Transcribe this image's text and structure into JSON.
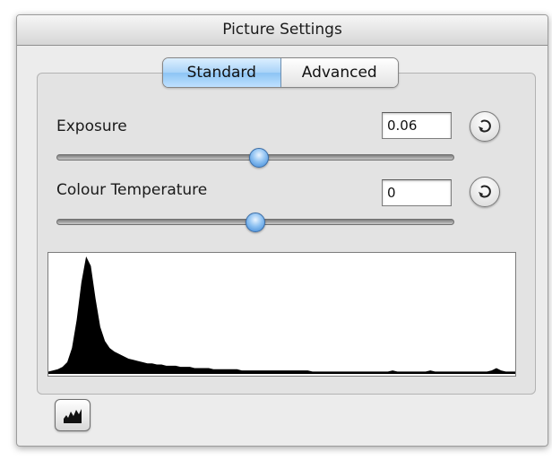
{
  "window": {
    "title": "Picture Settings"
  },
  "tabs": [
    {
      "label": "Standard",
      "selected": true
    },
    {
      "label": "Advanced",
      "selected": false
    }
  ],
  "exposure": {
    "label": "Exposure",
    "value": "0.06",
    "slider_fraction": 0.51,
    "reset_icon": "reset-arrow-icon"
  },
  "colour_temperature": {
    "label": "Colour Temperature",
    "value": "0",
    "slider_fraction": 0.5,
    "reset_icon": "reset-arrow-icon"
  },
  "histogram": {
    "values": [
      2,
      3,
      4,
      6,
      10,
      22,
      46,
      78,
      100,
      92,
      64,
      40,
      28,
      22,
      19,
      17,
      15,
      13,
      12,
      11,
      10,
      9,
      9,
      8,
      8,
      7,
      7,
      7,
      6,
      6,
      6,
      5,
      5,
      5,
      5,
      4,
      4,
      4,
      4,
      4,
      4,
      3,
      3,
      3,
      3,
      3,
      3,
      3,
      3,
      3,
      3,
      3,
      3,
      3,
      3,
      3,
      2,
      2,
      2,
      2,
      2,
      2,
      2,
      2,
      2,
      2,
      2,
      2,
      2,
      2,
      2,
      2,
      2,
      3,
      2,
      2,
      2,
      2,
      2,
      2,
      2,
      3,
      2,
      2,
      2,
      2,
      2,
      2,
      2,
      2,
      2,
      2,
      2,
      2,
      3,
      5,
      3,
      2,
      2,
      2
    ],
    "fill_color": "#000000"
  },
  "histogram_button": {
    "icon": "histogram-icon"
  },
  "colors": {
    "selected_tab": "#9ccbf6",
    "slider_knob": "#5b9be0",
    "panel_bg": "#ececec"
  }
}
